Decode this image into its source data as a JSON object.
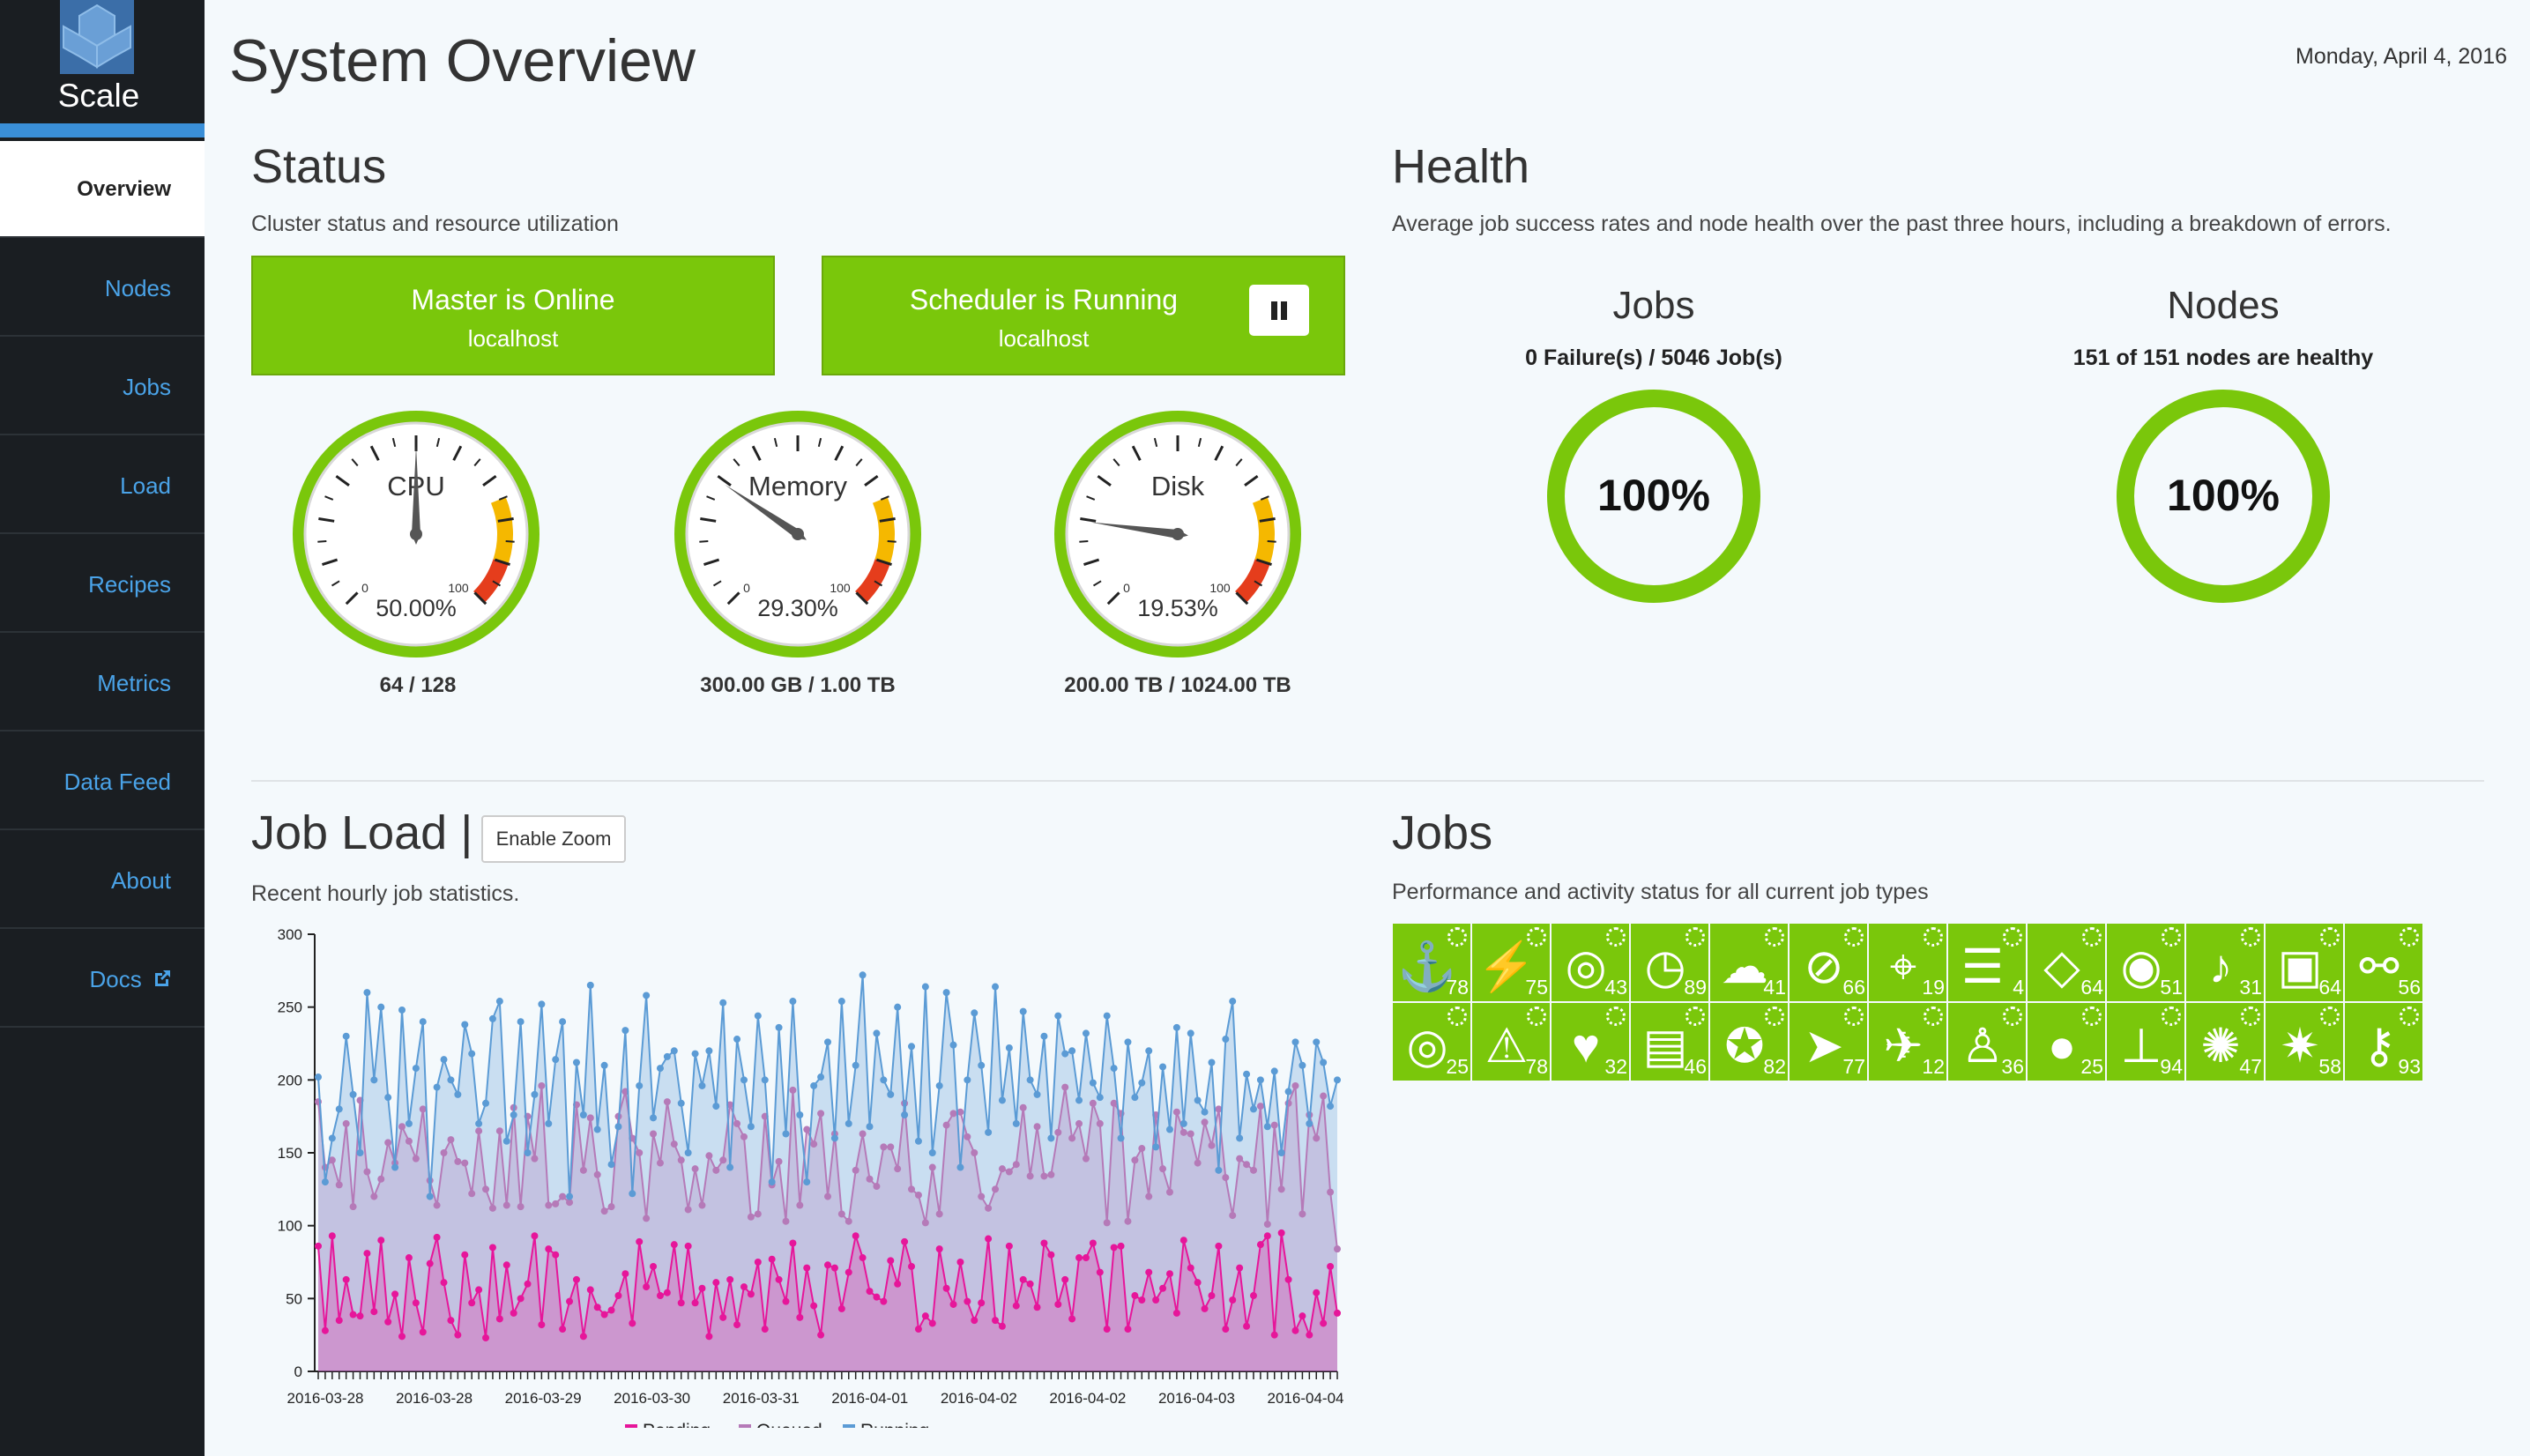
{
  "app": {
    "name": "Scale",
    "title": "System Overview",
    "date": "Monday, April 4, 2016"
  },
  "nav": [
    {
      "label": "Overview"
    },
    {
      "label": "Nodes"
    },
    {
      "label": "Jobs"
    },
    {
      "label": "Load"
    },
    {
      "label": "Recipes"
    },
    {
      "label": "Metrics"
    },
    {
      "label": "Data Feed"
    },
    {
      "label": "About"
    },
    {
      "label": "Docs"
    }
  ],
  "status": {
    "title": "Status",
    "subtitle": "Cluster status and resource utilization",
    "master": {
      "label": "Master is Online",
      "host": "localhost"
    },
    "scheduler": {
      "label": "Scheduler is Running",
      "host": "localhost",
      "pause_icon": "pause-icon"
    },
    "gauges": [
      {
        "name": "CPU",
        "percent": "50.00%",
        "value": 50.0,
        "caption": "64 / 128",
        "min": "0",
        "max": "100"
      },
      {
        "name": "Memory",
        "percent": "29.30%",
        "value": 29.3,
        "caption": "300.00 GB / 1.00 TB",
        "min": "0",
        "max": "100"
      },
      {
        "name": "Disk",
        "percent": "19.53%",
        "value": 19.53,
        "caption": "200.00 TB / 1024.00 TB",
        "min": "0",
        "max": "100"
      }
    ]
  },
  "health": {
    "title": "Health",
    "subtitle": "Average job success rates and node health over the past three hours, including a breakdown of errors.",
    "jobs": {
      "title": "Jobs",
      "summary": "0 Failure(s) / 5046 Job(s)",
      "percent": "100%",
      "value": 100
    },
    "nodes": {
      "title": "Nodes",
      "summary": "151 of 151 nodes are healthy",
      "percent": "100%",
      "value": 100
    }
  },
  "jobload": {
    "title": "Job Load |",
    "zoom_button": "Enable Zoom",
    "subtitle": "Recent hourly job statistics."
  },
  "jobtypes": {
    "title": "Jobs",
    "subtitle": "Performance and activity status for all current job types",
    "items": [
      {
        "icon": "anchor-icon",
        "glyph": "⚓",
        "count": "78"
      },
      {
        "icon": "bolt-icon",
        "glyph": "⚡",
        "count": "75"
      },
      {
        "icon": "target-icon",
        "glyph": "◎",
        "count": "43"
      },
      {
        "icon": "clock-icon",
        "glyph": "◷",
        "count": "89"
      },
      {
        "icon": "cloud-icon",
        "glyph": "☁",
        "count": "41"
      },
      {
        "icon": "compass-icon",
        "glyph": "⊘",
        "count": "66"
      },
      {
        "icon": "crosshairs-icon",
        "glyph": "⌖",
        "count": "19"
      },
      {
        "icon": "database-icon",
        "glyph": "☰",
        "count": "4"
      },
      {
        "icon": "diamond-icon",
        "glyph": "◇",
        "count": "64"
      },
      {
        "icon": "eye-icon",
        "glyph": "◉",
        "count": "51"
      },
      {
        "icon": "bell-icon",
        "glyph": "♪",
        "count": "31"
      },
      {
        "icon": "camera-icon",
        "glyph": "▣",
        "count": "64"
      },
      {
        "icon": "unlink-icon",
        "glyph": "⚯",
        "count": "56"
      },
      {
        "icon": "dot-circle-icon",
        "glyph": "◎",
        "count": "25"
      },
      {
        "icon": "warning-icon",
        "glyph": "⚠",
        "count": "78"
      },
      {
        "icon": "heartbeat-icon",
        "glyph": "♥",
        "count": "32"
      },
      {
        "icon": "map-icon",
        "glyph": "▤",
        "count": "46"
      },
      {
        "icon": "safari-icon",
        "glyph": "✪",
        "count": "82"
      },
      {
        "icon": "paper-plane-icon",
        "glyph": "➤",
        "count": "77"
      },
      {
        "icon": "space-shuttle-icon",
        "glyph": "✈",
        "count": "12"
      },
      {
        "icon": "street-view-icon",
        "glyph": "♙",
        "count": "36"
      },
      {
        "icon": "user-icon",
        "glyph": "●",
        "count": "25"
      },
      {
        "icon": "thumb-tack-icon",
        "glyph": "⊥",
        "count": "94"
      },
      {
        "icon": "rebel-icon",
        "glyph": "✺",
        "count": "47"
      },
      {
        "icon": "empire-icon",
        "glyph": "✷",
        "count": "58"
      },
      {
        "icon": "key-icon",
        "glyph": "⚷",
        "count": "93"
      }
    ]
  },
  "chart_data": {
    "type": "area",
    "series": [
      {
        "name": "Pending",
        "color": "#e6169a",
        "values": [
          86,
          28,
          93,
          35,
          63,
          39,
          38,
          81,
          41,
          90,
          34,
          53,
          24,
          78,
          47,
          27,
          74,
          92,
          61,
          35,
          25,
          80,
          47,
          56,
          23,
          85,
          36,
          73,
          40,
          50,
          60,
          93,
          32,
          84,
          80,
          29,
          48,
          63,
          24,
          56,
          44,
          39,
          42,
          52,
          67,
          33,
          89,
          58,
          72,
          52,
          54,
          87,
          47,
          86,
          47,
          57,
          24,
          61,
          37,
          63,
          32,
          58,
          53,
          75,
          29,
          77,
          63,
          48,
          88,
          37,
          71,
          45,
          25,
          73,
          71,
          43,
          68,
          93,
          78,
          55,
          51,
          48,
          76,
          60,
          89,
          72,
          29,
          38,
          33,
          84,
          57,
          46,
          75,
          48,
          35,
          47,
          91,
          35,
          31,
          86,
          45,
          63,
          60,
          44,
          88,
          80,
          46,
          63,
          36,
          78,
          78,
          88,
          68,
          29,
          85,
          86,
          29,
          52,
          49,
          68,
          49,
          57,
          67,
          40,
          90,
          71,
          61,
          43,
          52,
          86,
          29,
          49,
          71,
          31,
          52,
          87,
          93,
          25,
          95,
          63,
          28,
          38,
          25,
          54,
          33,
          72,
          40
        ]
      },
      {
        "name": "Queued",
        "color": "#b57ab8",
        "values": [
          185,
          140,
          145,
          128,
          170,
          113,
          186,
          137,
          120,
          132,
          157,
          143,
          168,
          158,
          146,
          180,
          131,
          114,
          150,
          159,
          144,
          143,
          122,
          165,
          125,
          112,
          165,
          114,
          181,
          113,
          175,
          146,
          196,
          114,
          115,
          120,
          116,
          183,
          138,
          174,
          135,
          110,
          113,
          175,
          192,
          160,
          150,
          105,
          163,
          143,
          185,
          156,
          145,
          111,
          139,
          114,
          148,
          138,
          145,
          183,
          170,
          161,
          106,
          108,
          175,
          128,
          144,
          103,
          193,
          114,
          166,
          156,
          177,
          120,
          163,
          108,
          103,
          138,
          163,
          132,
          127,
          154,
          154,
          139,
          184,
          125,
          121,
          102,
          140,
          108,
          169,
          177,
          178,
          161,
          150,
          120,
          112,
          125,
          139,
          137,
          142,
          181,
          134,
          168,
          134,
          135,
          164,
          195,
          160,
          170,
          146,
          184,
          170,
          102,
          184,
          177,
          103,
          145,
          153,
          120,
          176,
          139,
          123,
          178,
          164,
          163,
          143,
          171,
          155,
          180,
          133,
          107,
          146,
          142,
          138,
          182,
          101,
          169,
          125,
          184,
          196,
          108,
          176,
          160,
          189,
          123,
          84
        ]
      },
      {
        "name": "Running",
        "color": "#5b9bd5",
        "values": [
          202,
          130,
          160,
          180,
          230,
          190,
          150,
          260,
          200,
          250,
          188,
          140,
          248,
          170,
          208,
          240,
          120,
          195,
          214,
          200,
          190,
          238,
          218,
          170,
          184,
          242,
          254,
          158,
          176,
          240,
          150,
          190,
          252,
          170,
          214,
          240,
          120,
          212,
          176,
          265,
          166,
          210,
          142,
          168,
          234,
          122,
          196,
          258,
          174,
          208,
          216,
          220,
          184,
          150,
          218,
          196,
          220,
          182,
          253,
          140,
          228,
          200,
          168,
          244,
          200,
          130,
          236,
          163,
          254,
          176,
          130,
          196,
          202,
          226,
          160,
          254,
          170,
          210,
          272,
          168,
          232,
          200,
          190,
          250,
          176,
          223,
          158,
          264,
          150,
          196,
          260,
          224,
          140,
          200,
          246,
          210,
          164,
          264,
          186,
          222,
          170,
          247,
          200,
          190,
          230,
          160,
          244,
          218,
          220,
          186,
          232,
          198,
          188,
          244,
          208,
          160,
          226,
          188,
          198,
          220,
          154,
          209,
          166,
          236,
          170,
          232,
          186,
          178,
          212,
          138,
          228,
          254,
          160,
          204,
          180,
          200,
          168,
          206,
          150,
          192,
          226,
          210,
          170,
          226,
          212,
          182,
          200
        ]
      }
    ],
    "x_ticks": [
      "2016-03-28",
      "2016-03-28",
      "2016-03-29",
      "2016-03-30",
      "2016-03-31",
      "2016-04-01",
      "2016-04-02",
      "2016-04-02",
      "2016-04-03",
      "2016-04-04"
    ],
    "y_ticks": [
      0,
      50,
      100,
      150,
      200,
      250,
      300
    ],
    "ylim": [
      0,
      300
    ],
    "legend": "bottom-center"
  }
}
